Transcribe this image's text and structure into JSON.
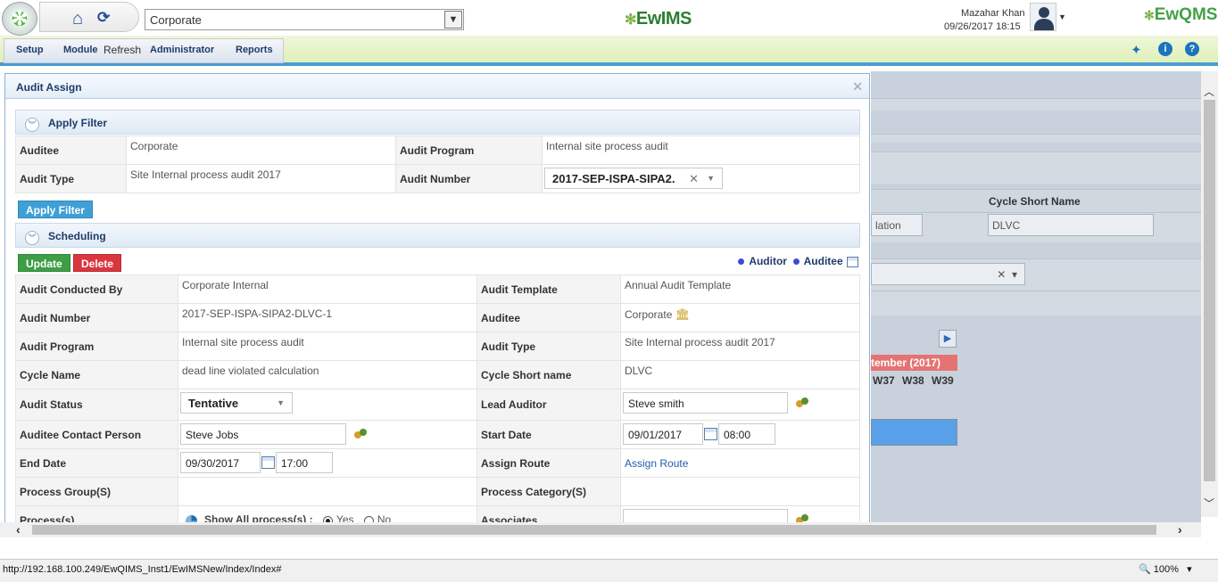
{
  "header": {
    "corporate_select": "Corporate",
    "app_logo": "EwIMS",
    "user_name": "Mazahar Khan",
    "user_datetime": "09/26/2017 18:15",
    "brand_logo": "EwQMS"
  },
  "menu": {
    "items": [
      "Setup",
      "Module",
      "Refresh",
      "Administrator",
      "Reports"
    ]
  },
  "dialog": {
    "title": "Audit Assign",
    "apply_filter": {
      "heading": "Apply Filter",
      "auditee_label": "Auditee",
      "auditee_value": "Corporate",
      "audit_program_label": "Audit Program",
      "audit_program_value": "Internal site process audit",
      "audit_type_label": "Audit Type",
      "audit_type_value": "Site Internal process audit 2017",
      "audit_number_label": "Audit Number",
      "audit_number_value": "2017-SEP-ISPA-SIPA2.",
      "apply_button": "Apply Filter"
    },
    "scheduling": {
      "heading": "Scheduling",
      "update_button": "Update",
      "delete_button": "Delete",
      "legend_auditor": "Auditor",
      "legend_auditee": "Auditee",
      "rows": {
        "conducted_by_label": "Audit Conducted By",
        "conducted_by_value": "Corporate Internal",
        "template_label": "Audit Template",
        "template_value": "Annual Audit Template",
        "number_label": "Audit Number",
        "number_value": "2017-SEP-ISPA-SIPA2-DLVC-1",
        "auditee_label": "Auditee",
        "auditee_value": "Corporate",
        "program_label": "Audit Program",
        "program_value": "Internal site process audit",
        "type_label": "Audit Type",
        "type_value": "Site Internal process audit 2017",
        "cycle_name_label": "Cycle Name",
        "cycle_name_value": "dead line violated calculation",
        "cycle_short_label": "Cycle Short name",
        "cycle_short_value": "DLVC",
        "status_label": "Audit Status",
        "status_value": "Tentative",
        "lead_auditor_label": "Lead Auditor",
        "lead_auditor_value": "Steve smith",
        "contact_label": "Auditee Contact Person",
        "contact_value": "Steve Jobs",
        "start_date_label": "Start Date",
        "start_date_value": "09/01/2017",
        "start_time_value": "08:00",
        "end_date_label": "End Date",
        "end_date_value": "09/30/2017",
        "end_time_value": "17:00",
        "assign_route_label": "Assign Route",
        "assign_route_link": "Assign Route",
        "process_group_label": "Process Group(S)",
        "process_category_label": "Process Category(S)",
        "processes_label": "Process(s)",
        "show_all_label": "Show All process(s) :",
        "yes_label": "Yes",
        "no_label": "No",
        "associates_label": "Associates",
        "associates_value": ""
      }
    }
  },
  "background": {
    "cycle_short_name_header": "Cycle Short Name",
    "cycle_name_partial": "lation",
    "cycle_short_name_value": "DLVC",
    "month_label": "tember (2017)",
    "weeks": [
      "W37",
      "W38",
      "W39"
    ]
  },
  "statusbar": {
    "url": "http://192.168.100.249/EwQIMS_Inst1/EwIMSNew/Index/Index#",
    "zoom": "100%"
  },
  "colors": {
    "accent_blue": "#1b75bc",
    "menu_green": "#dff0b8",
    "update_green": "#3d9e46",
    "delete_red": "#d9363e",
    "apply_blue": "#3fa0d6",
    "month_red": "#e57373"
  }
}
